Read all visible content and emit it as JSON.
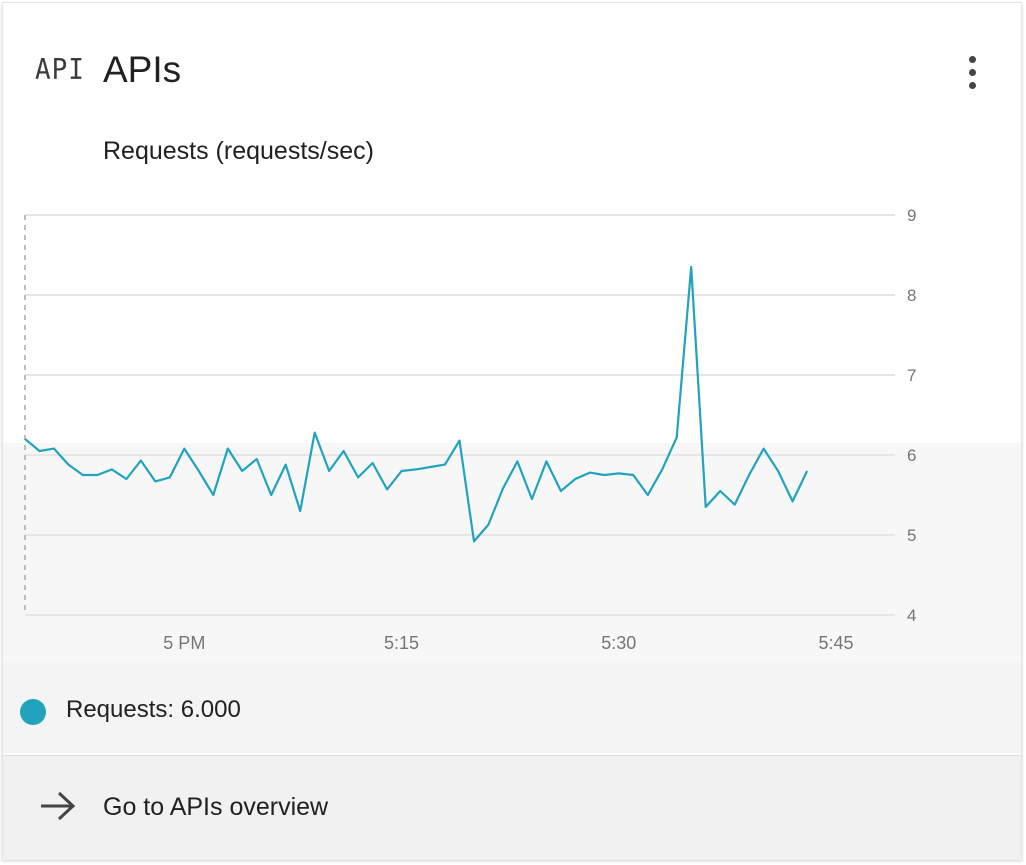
{
  "header": {
    "glyph_text": "API",
    "title": "APIs"
  },
  "chart_data": {
    "type": "line",
    "title": "Requests (requests/sec)",
    "xlabel": "",
    "ylabel": "",
    "ylim": [
      4,
      9
    ],
    "y_ticks": [
      "4",
      "5",
      "6",
      "7",
      "8",
      "9"
    ],
    "x_ticks": [
      {
        "label": "5 PM",
        "value": 5
      },
      {
        "label": "5:15",
        "value": 20
      },
      {
        "label": "5:30",
        "value": 35
      },
      {
        "label": "5:45",
        "value": 50
      }
    ],
    "xlim": [
      -6,
      52
    ],
    "grid": true,
    "line_color": "#22a3bd",
    "series": [
      {
        "name": "Requests",
        "x": [
          -6,
          -5,
          -4,
          -3,
          -2,
          -1,
          0,
          1,
          2,
          3,
          4,
          5,
          6,
          7,
          8,
          9,
          10,
          11,
          12,
          13,
          14,
          15,
          16,
          17,
          18,
          19,
          20,
          21,
          22,
          23,
          24,
          25,
          26,
          27,
          28,
          29,
          30,
          31,
          32,
          33,
          34,
          35,
          36,
          37,
          38,
          39,
          40,
          41,
          42,
          43,
          44,
          45,
          46,
          47,
          48
        ],
        "values": [
          6.2,
          6.05,
          6.08,
          5.88,
          5.75,
          5.75,
          5.82,
          5.7,
          5.93,
          5.67,
          5.72,
          6.08,
          5.8,
          5.5,
          6.08,
          5.8,
          5.95,
          5.5,
          5.88,
          5.3,
          6.28,
          5.8,
          6.05,
          5.72,
          5.9,
          5.57,
          5.8,
          5.82,
          5.85,
          5.88,
          6.18,
          4.92,
          5.13,
          5.58,
          5.92,
          5.45,
          5.92,
          5.55,
          5.7,
          5.78,
          5.75,
          5.77,
          5.75,
          5.5,
          5.82,
          6.22,
          8.35,
          5.35,
          5.55,
          5.38,
          5.75,
          6.08,
          5.8,
          5.42,
          5.8
        ]
      }
    ]
  },
  "legend": {
    "name": "Requests:",
    "value": "6.000",
    "color": "#22a3bd"
  },
  "footer": {
    "label": "Go to APIs overview",
    "icon": "arrow-right-icon"
  }
}
